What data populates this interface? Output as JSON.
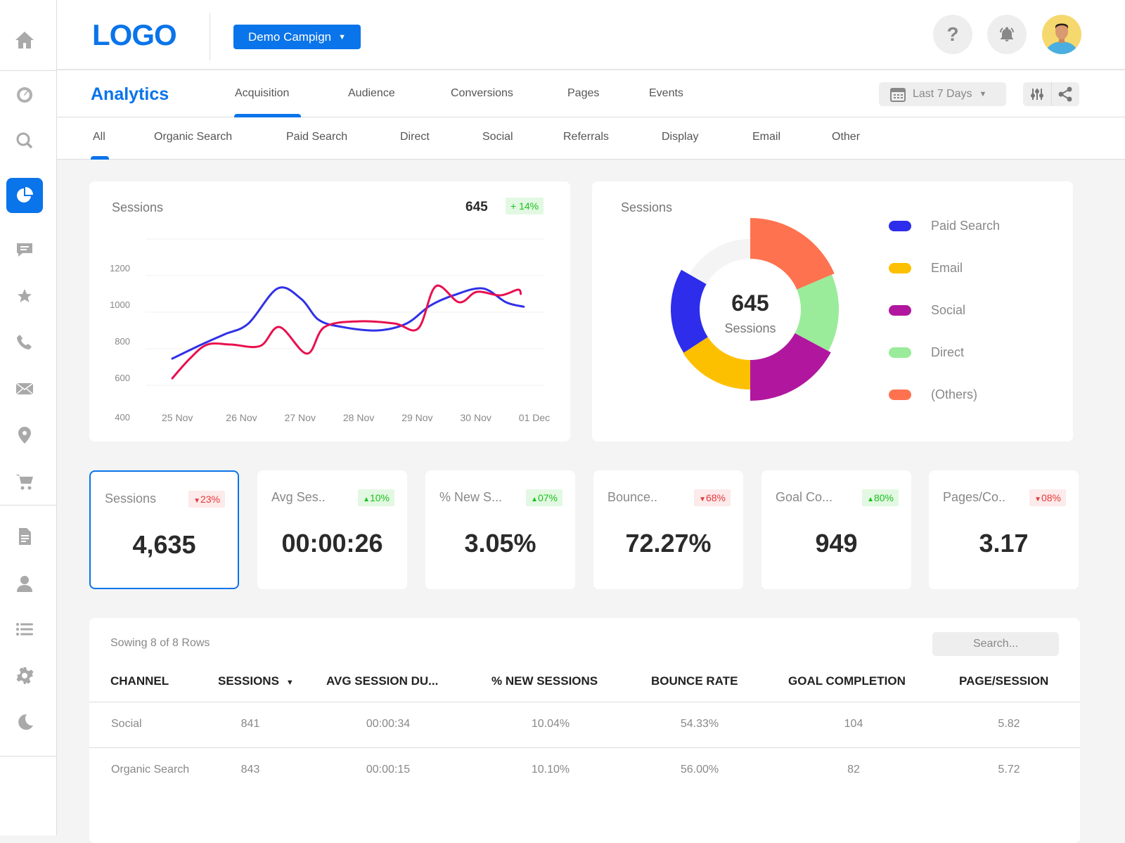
{
  "header": {
    "logo": "LOGO",
    "campaign": "Demo Campign",
    "help_icon": "question-icon",
    "notification_icon": "bell-icon"
  },
  "nav": {
    "title": "Analytics",
    "tabs": [
      "Acquisition",
      "Audience",
      "Conversions",
      "Pages",
      "Events"
    ],
    "active_tab": "Acquisition",
    "date_range": "Last 7 Days"
  },
  "subnav": {
    "tabs": [
      "All",
      "Organic Search",
      "Paid Search",
      "Direct",
      "Social",
      "Referrals",
      "Display",
      "Email",
      "Other"
    ],
    "active": "All"
  },
  "sidebar": {
    "icons": [
      "home-icon",
      "dashboard-gauge-icon",
      "search-icon",
      "pie-chart-icon",
      "chat-icon",
      "star-icon",
      "phone-icon",
      "mail-icon",
      "location-pin-icon",
      "cart-icon",
      "document-icon",
      "user-icon",
      "list-icon",
      "settings-gear-icon",
      "moon-icon"
    ],
    "active": "pie-chart-icon"
  },
  "colors": {
    "accent": "#0a74ea",
    "paid_search": "#2d2deb",
    "email": "#fdc000",
    "social": "#b0179e",
    "direct": "#9aeb9a",
    "others": "#ff7250",
    "line_blue": "#3030e8",
    "line_red": "#e8104f",
    "up": "#1ac21a",
    "down": "#e5383b"
  },
  "chart_data": [
    {
      "type": "line",
      "title": "Sessions",
      "total": "645",
      "change": "+ 14%",
      "x_ticks": [
        "25 Nov",
        "26 Nov",
        "27 Nov",
        "28 Nov",
        "29 Nov",
        "30 Nov",
        "01 Dec"
      ],
      "y_ticks": [
        "400",
        "600",
        "800",
        "1000",
        "1200"
      ],
      "ylim": [
        400,
        1400
      ],
      "grid": true,
      "series": [
        {
          "color": "#3030e8",
          "points": [
            [
              0,
              746
            ],
            [
              0.5,
              823
            ],
            [
              0.9,
              880
            ],
            [
              1.3,
              938
            ],
            [
              1.8,
              1130
            ],
            [
              2.2,
              1073
            ],
            [
              2.5,
              958
            ],
            [
              2.9,
              919
            ],
            [
              3.5,
              900
            ],
            [
              4.0,
              938
            ],
            [
              4.4,
              1035
            ],
            [
              4.8,
              1092
            ],
            [
              5.3,
              1130
            ],
            [
              5.7,
              1054
            ],
            [
              6.0,
              1030
            ]
          ]
        },
        {
          "color": "#e8104f",
          "points": [
            [
              0,
              638
            ],
            [
              0.3,
              746
            ],
            [
              0.6,
              823
            ],
            [
              1.0,
              823
            ],
            [
              1.5,
              815
            ],
            [
              1.83,
              919
            ],
            [
              2.3,
              773
            ],
            [
              2.6,
              919
            ],
            [
              3.2,
              950
            ],
            [
              3.8,
              938
            ],
            [
              4.2,
              911
            ],
            [
              4.5,
              1142
            ],
            [
              4.9,
              1054
            ],
            [
              5.2,
              1111
            ],
            [
              5.6,
              1092
            ],
            [
              5.9,
              1123
            ],
            [
              5.95,
              1100
            ]
          ]
        }
      ]
    },
    {
      "type": "pie",
      "title": "Sessions",
      "center_value": "645",
      "center_label": "Sessions",
      "slices": [
        {
          "label": "(Others)",
          "value": 18.6,
          "color": "#ff7250"
        },
        {
          "label": "Direct",
          "value": 14.2,
          "color": "#9aeb9a"
        },
        {
          "label": "Social",
          "value": 17.2,
          "color": "#b0179e"
        },
        {
          "label": "Email",
          "value": 15.8,
          "color": "#fdc000"
        },
        {
          "label": "Paid Search",
          "value": 17.5,
          "color": "#2d2deb"
        }
      ],
      "legend": [
        "Paid Search",
        "Email",
        "Social",
        "Direct",
        "(Others)"
      ],
      "legend_position": "right"
    }
  ],
  "kpis": [
    {
      "label": "Sessions",
      "change": "23%",
      "dir": "down",
      "value": "4,635"
    },
    {
      "label": "Avg Ses..",
      "change": "10%",
      "dir": "up",
      "value": "00:00:26"
    },
    {
      "label": "% New S...",
      "change": "07%",
      "dir": "up",
      "value": "3.05%"
    },
    {
      "label": "Bounce..",
      "change": "68%",
      "dir": "down",
      "value": "72.27%"
    },
    {
      "label": "Goal Co...",
      "change": "80%",
      "dir": "up",
      "value": "949"
    },
    {
      "label": "Pages/Co..",
      "change": "08%",
      "dir": "down",
      "value": "3.17"
    }
  ],
  "table": {
    "summary": "Sowing 8 of 8 Rows",
    "search_placeholder": "Search...",
    "columns": [
      "CHANNEL",
      "SESSIONS",
      "AVG SESSION DU...",
      "% NEW SESSIONS",
      "BOUNCE RATE",
      "GOAL COMPLETION",
      "PAGE/SESSION"
    ],
    "sort_column": "SESSIONS",
    "rows": [
      [
        "Social",
        "841",
        "00:00:34",
        "10.04%",
        "54.33%",
        "104",
        "5.82"
      ],
      [
        "Organic Search",
        "843",
        "00:00:15",
        "10.10%",
        "56.00%",
        "82",
        "5.72"
      ]
    ]
  }
}
